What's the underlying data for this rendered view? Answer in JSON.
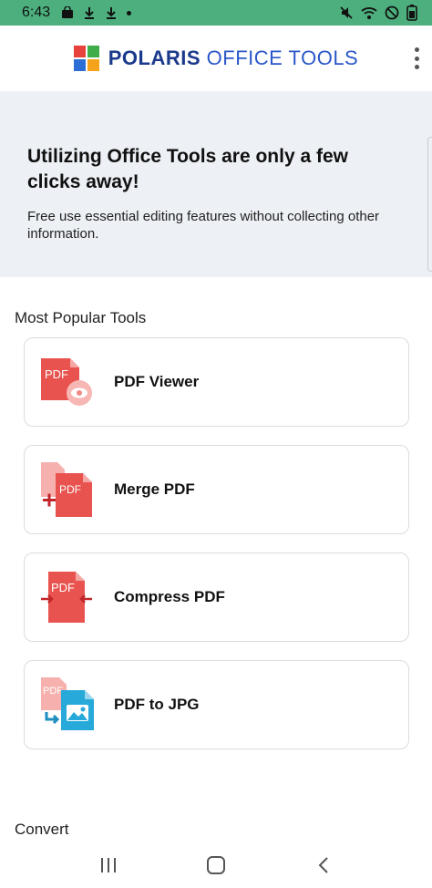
{
  "status_bar": {
    "time": "6:43"
  },
  "header": {
    "brand_bold": "POLARIS",
    "brand_light": "OFFICE TOOLS",
    "logo_colors": [
      "#e8403a",
      "#3fae4a",
      "#2b6fd6",
      "#f4a31b"
    ]
  },
  "hero": {
    "title": "Utilizing Office Tools are only a few clicks away!",
    "description": "Free use essential editing features without collecting other information."
  },
  "sections": {
    "popular_title": "Most Popular Tools",
    "convert_title": "Convert"
  },
  "tools": [
    {
      "label": "PDF Viewer",
      "icon": "pdf-viewer-icon"
    },
    {
      "label": "Merge PDF",
      "icon": "merge-pdf-icon"
    },
    {
      "label": "Compress PDF",
      "icon": "compress-pdf-icon"
    },
    {
      "label": "PDF to JPG",
      "icon": "pdf-to-jpg-icon"
    }
  ],
  "icon_badge_text": "PDF",
  "colors": {
    "status_bar": "#4caf7d",
    "hero_bg": "#edf0f5",
    "pdf_red": "#e8534f",
    "pdf_light": "#f4a7a4",
    "jpg_blue": "#27a9d9"
  }
}
